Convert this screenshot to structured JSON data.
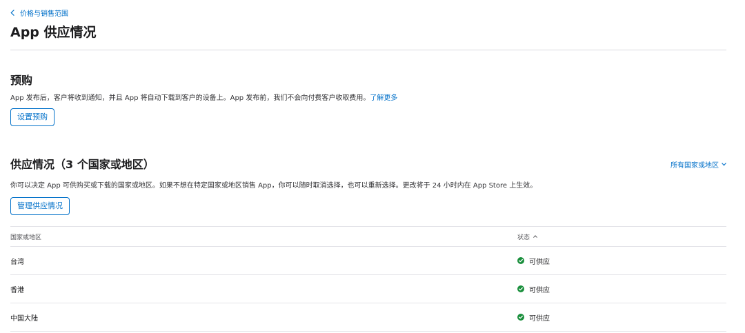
{
  "breadcrumb": {
    "label": "价格与销售范围"
  },
  "page": {
    "title": "App 供应情况"
  },
  "preorder": {
    "title": "预购",
    "description": "App 发布后，客户将收到通知，并且 App 将自动下载到客户的设备上。App 发布前，我们不会向付费客户收取费用。",
    "learn_more": "了解更多",
    "button": "设置预购"
  },
  "availability": {
    "title": "供应情况（3 个国家或地区）",
    "filter": "所有国家或地区",
    "description": "你可以决定 App 可供购买或下载的国家或地区。如果不想在特定国家或地区销售 App，你可以随时取消选择，也可以重新选择。更改将于 24 小时内在 App Store 上生效。",
    "button": "管理供应情况"
  },
  "table": {
    "headers": {
      "country": "国家或地区",
      "status": "状态"
    },
    "rows": [
      {
        "country": "台湾",
        "status": "可供应"
      },
      {
        "country": "香港",
        "status": "可供应"
      },
      {
        "country": "中国大陆",
        "status": "可供应"
      }
    ]
  },
  "colors": {
    "accent": "#0070c9",
    "status_ok": "#1a8f3c",
    "divider": "#d9d9de"
  },
  "icons": {
    "back": "chevron-left-icon",
    "filter": "chevron-down-icon",
    "sort": "chevron-up-icon",
    "status": "check-circle-icon"
  }
}
